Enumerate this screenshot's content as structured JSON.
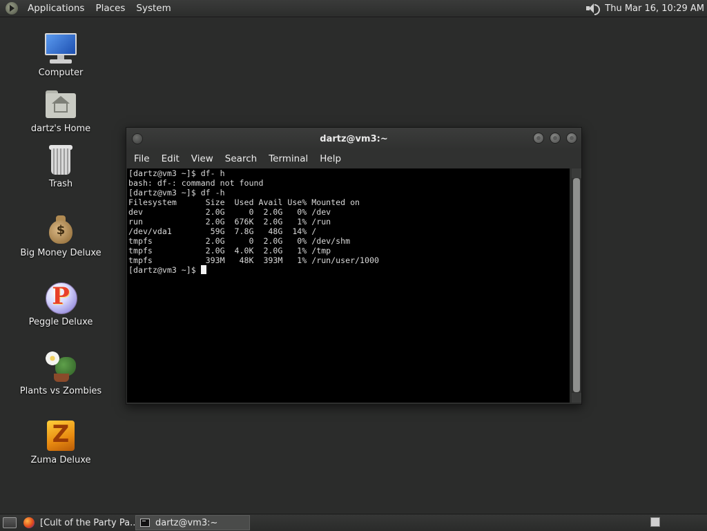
{
  "top_panel": {
    "menus": [
      "Applications",
      "Places",
      "System"
    ],
    "clock": "Thu Mar 16, 10:29 AM"
  },
  "desktop": {
    "icons": [
      {
        "label": "Computer",
        "icon": "computer-icon"
      },
      {
        "label": "dartz's Home",
        "icon": "home-folder-icon"
      },
      {
        "label": "Trash",
        "icon": "trash-icon"
      },
      {
        "label": "Big Money Deluxe",
        "icon": "money-bag-icon"
      },
      {
        "label": "Peggle Deluxe",
        "icon": "peggle-icon"
      },
      {
        "label": "Plants vs Zombies",
        "icon": "plants-vs-zombies-icon"
      },
      {
        "label": "Zuma Deluxe",
        "icon": "zuma-icon"
      }
    ]
  },
  "terminal": {
    "title": "dartz@vm3:~",
    "menus": [
      "File",
      "Edit",
      "View",
      "Search",
      "Terminal",
      "Help"
    ],
    "output": "[dartz@vm3 ~]$ df- h\nbash: df-: command not found\n[dartz@vm3 ~]$ df -h\nFilesystem      Size  Used Avail Use% Mounted on\ndev             2.0G     0  2.0G   0% /dev\nrun             2.0G  676K  2.0G   1% /run\n/dev/vda1        59G  7.8G   48G  14% /\ntmpfs           2.0G     0  2.0G   0% /dev/shm\ntmpfs           2.0G  4.0K  2.0G   1% /tmp\ntmpfs           393M   48K  393M   1% /run/user/1000\n",
    "prompt": "[dartz@vm3 ~]$ "
  },
  "taskbar": {
    "tasks": [
      {
        "label": "[Cult of the Party Pa...",
        "icon": "firefox-icon",
        "active": false
      },
      {
        "label": "dartz@vm3:~",
        "icon": "terminal-icon",
        "active": true
      }
    ]
  }
}
